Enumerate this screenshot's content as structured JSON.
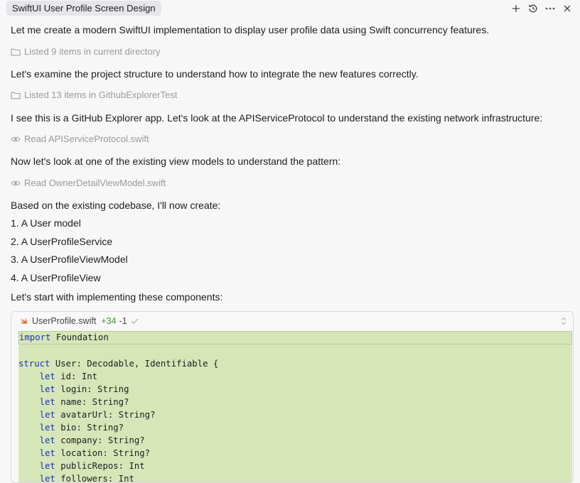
{
  "window": {
    "title": "SwiftUI User Profile Screen Design",
    "actions": [
      "plus-icon",
      "history-icon",
      "more-icon",
      "close-icon"
    ]
  },
  "messages": [
    {
      "type": "text",
      "text": "Let me create a modern SwiftUI implementation to display user profile data using Swift concurrency features."
    },
    {
      "type": "tool",
      "icon": "folder-icon",
      "text": "Listed 9 items in current directory"
    },
    {
      "type": "text",
      "text": "Let's examine the project structure to understand how to integrate the new features correctly."
    },
    {
      "type": "tool",
      "icon": "folder-icon",
      "text": "Listed 13 items in GithubExplorerTest"
    },
    {
      "type": "text",
      "text": "I see this is a GitHub Explorer app. Let's look at the APIServiceProtocol to understand the existing network infrastructure:"
    },
    {
      "type": "tool",
      "icon": "eye-icon",
      "text": "Read APIServiceProtocol.swift"
    },
    {
      "type": "text",
      "text": "Now let's look at one of the existing view models to understand the pattern:"
    },
    {
      "type": "tool",
      "icon": "eye-icon",
      "text": "Read OwnerDetailViewModel.swift"
    },
    {
      "type": "text",
      "text": "Based on the existing codebase, I'll now create:"
    },
    {
      "type": "text",
      "text": "1. A User model"
    },
    {
      "type": "text",
      "text": "2. A UserProfileService"
    },
    {
      "type": "text",
      "text": "3. A UserProfileViewModel"
    },
    {
      "type": "text",
      "text": "4. A UserProfileView"
    },
    {
      "type": "text",
      "text": "Let's start with implementing these components:"
    }
  ],
  "code_block": {
    "filename": "UserProfile.swift",
    "additions": "+34",
    "deletions": "-1",
    "lines": [
      {
        "kw": "import",
        "rest": " Foundation"
      },
      {
        "kw": "",
        "rest": ""
      },
      {
        "kw": "struct",
        "rest": " User: Decodable, Identifiable {"
      },
      {
        "kw": "    let",
        "rest": " id: Int"
      },
      {
        "kw": "    let",
        "rest": " login: String"
      },
      {
        "kw": "    let",
        "rest": " name: String?"
      },
      {
        "kw": "    let",
        "rest": " avatarUrl: String?"
      },
      {
        "kw": "    let",
        "rest": " bio: String?"
      },
      {
        "kw": "    let",
        "rest": " company: String?"
      },
      {
        "kw": "    let",
        "rest": " location: String?"
      },
      {
        "kw": "    let",
        "rest": " publicRepos: Int"
      },
      {
        "kw": "    let",
        "rest": " followers: Int"
      }
    ]
  },
  "colors": {
    "background": "#f7f7f8",
    "code_added_bg": "#d7e6b8",
    "keyword": "#1a34b8",
    "additions": "#4a8d35"
  }
}
